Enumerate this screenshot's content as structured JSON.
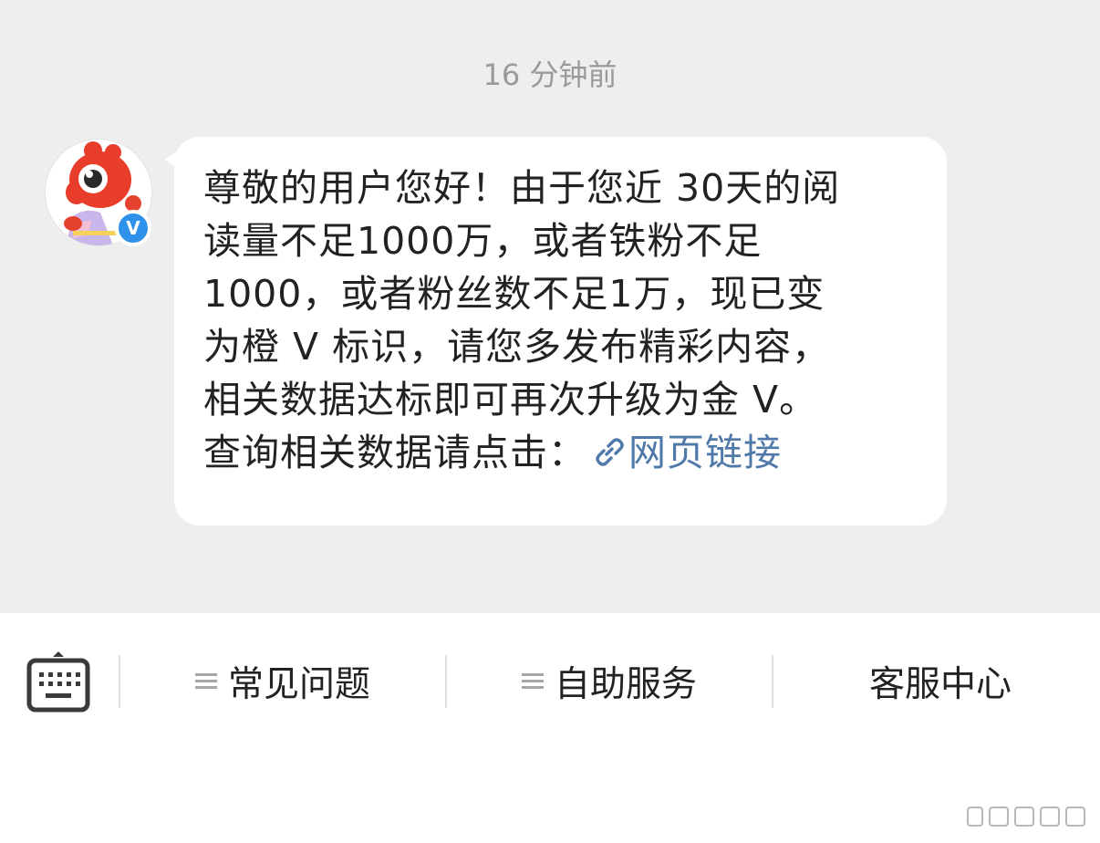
{
  "chat": {
    "timestamp": "16 分钟前",
    "message": {
      "lines": [
        "尊敬的用户您好！由于您近 30天的阅",
        "读量不足1000万，或者铁粉不足",
        "1000，或者粉丝数不足1万，现已变",
        "为橙 V 标识，请您多发布精彩内容，",
        "相关数据达标即可再次升级为金 V。"
      ],
      "last_line_prefix": "查询相关数据请点击：",
      "link_label": "网页链接",
      "link_icon": "link-icon"
    },
    "avatar": {
      "icon": "weibo-mascot-avatar",
      "badge_label": "V",
      "badge_color": "#2e92ea"
    }
  },
  "toolbar": {
    "keyboard_icon": "keyboard-icon",
    "items": [
      {
        "label": "常见问题",
        "icon": "menu-lines-icon"
      },
      {
        "label": "自助服务",
        "icon": "menu-lines-icon"
      },
      {
        "label": "客服中心"
      }
    ]
  },
  "colors": {
    "chat_background": "#eeeeee",
    "bubble_background": "#ffffff",
    "link": "#4f79a8",
    "timestamp": "#9a9a9a",
    "text": "#222222"
  }
}
